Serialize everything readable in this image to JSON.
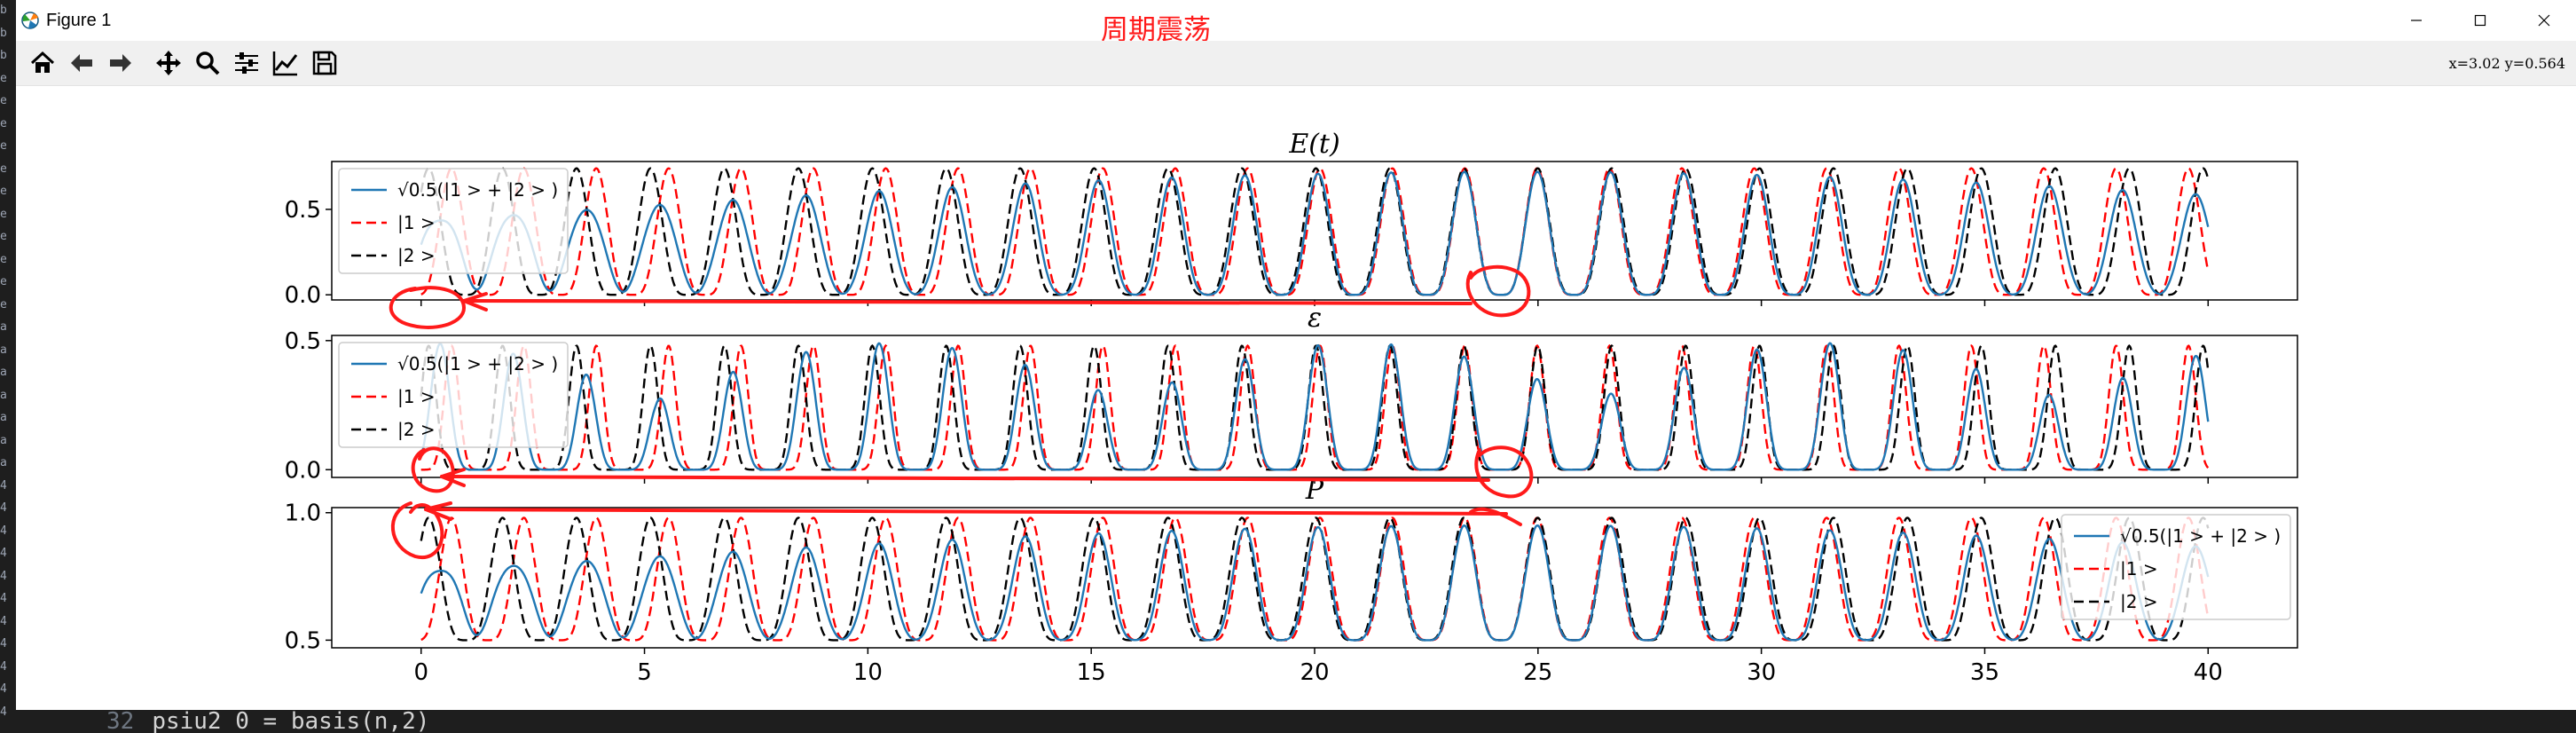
{
  "window": {
    "title": "Figure 1",
    "annotation": "周期震荡"
  },
  "toolbar": {
    "buttons": [
      {
        "name": "home",
        "icon": "home-icon"
      },
      {
        "name": "back",
        "icon": "arrow-left-icon"
      },
      {
        "name": "forward",
        "icon": "arrow-right-icon"
      },
      {
        "name": "pan",
        "icon": "move-icon"
      },
      {
        "name": "zoom",
        "icon": "magnifier-icon"
      },
      {
        "name": "configure-subplots",
        "icon": "sliders-icon"
      },
      {
        "name": "edit-axis",
        "icon": "line-chart-icon"
      },
      {
        "name": "save",
        "icon": "floppy-disk-icon"
      }
    ]
  },
  "status": {
    "coordinates": "x=3.02 y=0.564"
  },
  "left_strip_chars": [
    "b",
    "b",
    "b",
    "e",
    "e",
    "e",
    "e",
    "e",
    "e",
    "e",
    "e",
    "e",
    "e",
    "e",
    "a",
    "a",
    "a",
    "a",
    "a",
    "a",
    "a",
    "4",
    "4",
    "4",
    "4",
    "4",
    "4",
    "4",
    "4",
    "4",
    "4",
    "4"
  ],
  "bottom_code": {
    "line_number": "32",
    "text": "psiu2 0 = basis(n,2)"
  },
  "colors": {
    "series1": "#1f77b4",
    "series2": "#ff0000",
    "series3": "#000000",
    "annotation": "#ff1a1a"
  },
  "chart_data": [
    {
      "type": "line",
      "title": "E(t)",
      "xlim": [
        -2,
        42
      ],
      "ylim": [
        -0.03,
        0.78
      ],
      "yticks": [
        "0.0",
        "0.5"
      ],
      "ytick_values": [
        0.0,
        0.5
      ],
      "legend": {
        "position": "upper-left",
        "entries": [
          "√0.5(|1 > + |2 > )",
          "|1 >",
          "|2 >"
        ]
      },
      "series": [
        {
          "name": "√0.5(|1 > + |2 > )",
          "style": "solid",
          "color": "#1f77b4",
          "func": "mix",
          "amp": 0.72,
          "base": 0.0
        },
        {
          "name": "|1 >",
          "style": "dashed",
          "color": "#ff0000",
          "func": "s1",
          "amp": 0.74,
          "base": 0.0
        },
        {
          "name": "|2 >",
          "style": "dashed",
          "color": "#000000",
          "func": "s2",
          "amp": 0.74,
          "base": 0.0
        }
      ]
    },
    {
      "type": "line",
      "title": "ε",
      "xlim": [
        -2,
        42
      ],
      "ylim": [
        -0.03,
        0.52
      ],
      "yticks": [
        "0.0",
        "0.5"
      ],
      "ytick_values": [
        0.0,
        0.5
      ],
      "legend": {
        "position": "upper-left",
        "entries": [
          "√0.5(|1 > + |2 > )",
          "|1 >",
          "|2 >"
        ]
      },
      "series": [
        {
          "name": "√0.5(|1 > + |2 > )",
          "style": "solid",
          "color": "#1f77b4",
          "func": "mixsharp",
          "amp": 0.49,
          "base": 0.0
        },
        {
          "name": "|1 >",
          "style": "dashed",
          "color": "#ff0000",
          "func": "s1sharp",
          "amp": 0.48,
          "base": 0.0
        },
        {
          "name": "|2 >",
          "style": "dashed",
          "color": "#000000",
          "func": "s2sharp",
          "amp": 0.48,
          "base": 0.0
        }
      ]
    },
    {
      "type": "line",
      "title": "P",
      "xlim": [
        -2,
        42
      ],
      "ylim": [
        0.47,
        1.02
      ],
      "yticks": [
        "0.5",
        "1.0"
      ],
      "ytick_values": [
        0.5,
        1.0
      ],
      "xticks": [
        "0",
        "5",
        "10",
        "15",
        "20",
        "25",
        "30",
        "35",
        "40"
      ],
      "xtick_values": [
        0,
        5,
        10,
        15,
        20,
        25,
        30,
        35,
        40
      ],
      "legend": {
        "position": "upper-right",
        "entries": [
          "√0.5(|1 > + |2 > )",
          "|1 >",
          "|2 >"
        ]
      },
      "series": [
        {
          "name": "√0.5(|1 > + |2 > )",
          "style": "solid",
          "color": "#1f77b4",
          "func": "mix",
          "amp": 0.45,
          "base": 0.5
        },
        {
          "name": "|1 >",
          "style": "dashed",
          "color": "#ff0000",
          "func": "s1",
          "amp": 0.48,
          "base": 0.5
        },
        {
          "name": "|2 >",
          "style": "dashed",
          "color": "#000000",
          "func": "s2",
          "amp": 0.48,
          "base": 0.5
        }
      ]
    }
  ]
}
